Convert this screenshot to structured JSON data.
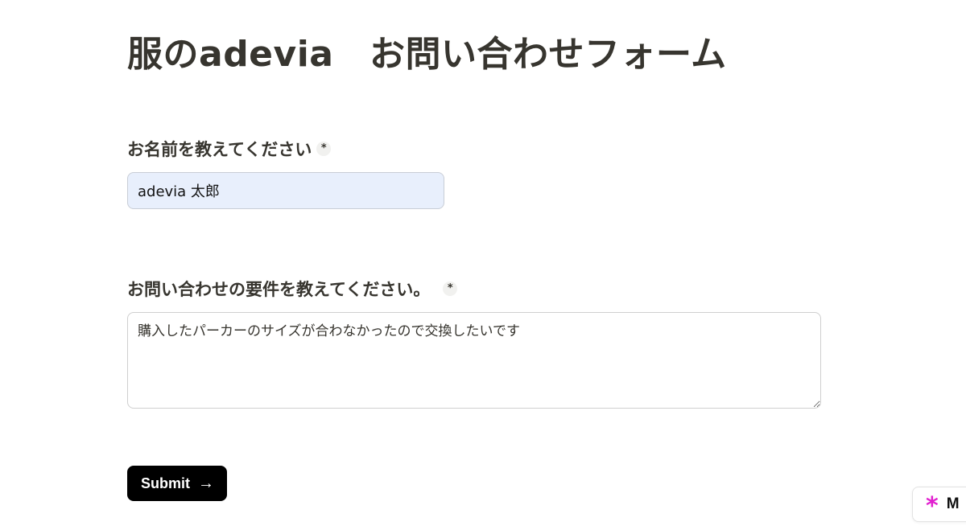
{
  "form": {
    "title": "服のadevia　お問い合わせフォーム",
    "questions": [
      {
        "label": "お名前を教えてください",
        "required_mark": "*",
        "value": "adevia 太郎"
      },
      {
        "label": "お問い合わせの要件を教えてください。",
        "required_mark": "*",
        "value": "購入したパーカーのサイズが合わなかったので交換したいです"
      }
    ],
    "submit_label": "Submit",
    "submit_icon": "→"
  },
  "badge": {
    "icon": "asterisk-icon",
    "icon_glyph": "*",
    "icon_color": "#e11fcf",
    "text": "M"
  }
}
